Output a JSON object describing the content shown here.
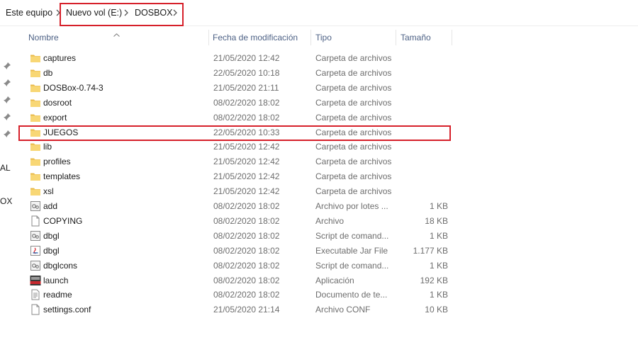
{
  "breadcrumb": {
    "items": [
      "Este equipo",
      "Nuevo vol (E:)",
      "DOSBOX"
    ]
  },
  "nav_pane": {
    "labels": [
      "AL",
      "OX"
    ]
  },
  "columns": {
    "name": "Nombre",
    "date": "Fecha de modificación",
    "type": "Tipo",
    "size": "Tamaño"
  },
  "files": [
    {
      "name": "captures",
      "date": "21/05/2020 12:42",
      "type": "Carpeta de archivos",
      "size": "",
      "icon": "folder-icon"
    },
    {
      "name": "db",
      "date": "22/05/2020 10:18",
      "type": "Carpeta de archivos",
      "size": "",
      "icon": "folder-icon"
    },
    {
      "name": "DOSBox-0.74-3",
      "date": "21/05/2020 21:11",
      "type": "Carpeta de archivos",
      "size": "",
      "icon": "folder-icon"
    },
    {
      "name": "dosroot",
      "date": "08/02/2020 18:02",
      "type": "Carpeta de archivos",
      "size": "",
      "icon": "folder-icon"
    },
    {
      "name": "export",
      "date": "08/02/2020 18:02",
      "type": "Carpeta de archivos",
      "size": "",
      "icon": "folder-icon"
    },
    {
      "name": "JUEGOS",
      "date": "22/05/2020 10:33",
      "type": "Carpeta de archivos",
      "size": "",
      "icon": "folder-icon"
    },
    {
      "name": "lib",
      "date": "21/05/2020 12:42",
      "type": "Carpeta de archivos",
      "size": "",
      "icon": "folder-icon"
    },
    {
      "name": "profiles",
      "date": "21/05/2020 12:42",
      "type": "Carpeta de archivos",
      "size": "",
      "icon": "folder-icon"
    },
    {
      "name": "templates",
      "date": "21/05/2020 12:42",
      "type": "Carpeta de archivos",
      "size": "",
      "icon": "folder-icon"
    },
    {
      "name": "xsl",
      "date": "21/05/2020 12:42",
      "type": "Carpeta de archivos",
      "size": "",
      "icon": "folder-icon"
    },
    {
      "name": "add",
      "date": "08/02/2020 18:02",
      "type": "Archivo por lotes ...",
      "size": "1 KB",
      "icon": "batch-file-icon"
    },
    {
      "name": "COPYING",
      "date": "08/02/2020 18:02",
      "type": "Archivo",
      "size": "18 KB",
      "icon": "file-icon"
    },
    {
      "name": "dbgl",
      "date": "08/02/2020 18:02",
      "type": "Script de comand...",
      "size": "1 KB",
      "icon": "script-file-icon"
    },
    {
      "name": "dbgl",
      "date": "08/02/2020 18:02",
      "type": "Executable Jar File",
      "size": "1.177 KB",
      "icon": "jar-file-icon"
    },
    {
      "name": "dbglcons",
      "date": "08/02/2020 18:02",
      "type": "Script de comand...",
      "size": "1 KB",
      "icon": "script-file-icon"
    },
    {
      "name": "launch",
      "date": "08/02/2020 18:02",
      "type": "Aplicación",
      "size": "192 KB",
      "icon": "app-dbgl-icon"
    },
    {
      "name": "readme",
      "date": "08/02/2020 18:02",
      "type": "Documento de te...",
      "size": "1 KB",
      "icon": "text-document-icon"
    },
    {
      "name": "settings.conf",
      "date": "21/05/2020 21:14",
      "type": "Archivo CONF",
      "size": "10 KB",
      "icon": "file-icon"
    }
  ],
  "colors": {
    "highlight_border": "#d6202a",
    "folder_yellow": "#f8d775",
    "header_text": "#4d6185"
  }
}
